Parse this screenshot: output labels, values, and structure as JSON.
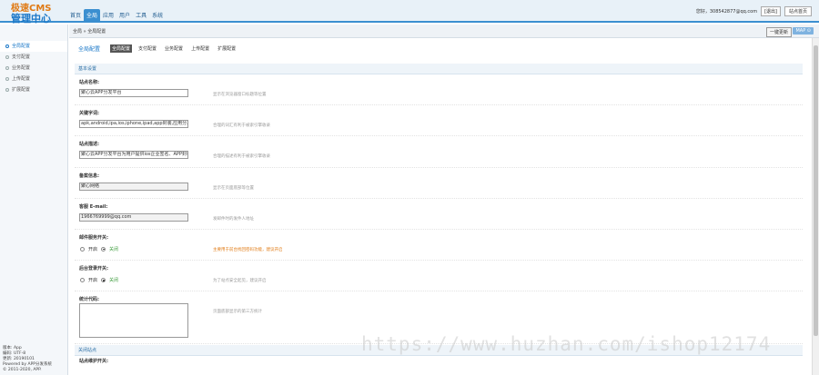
{
  "app": {
    "logo_line1": "极速CMS",
    "logo_line2": "管理中心"
  },
  "nav": [
    "首页",
    "全局",
    "应用",
    "用户",
    "工具",
    "系统"
  ],
  "user_bar": {
    "greeting": "您好，308542877@qq.com",
    "logout": "[退出]",
    "site_home": "站点首页"
  },
  "sidebar": {
    "items": [
      "全局配置",
      "支付配置",
      "业务配置",
      "上传配置",
      "扩展配置"
    ],
    "footer": [
      "版本: App",
      "编码: UTF-8",
      "更新: 20190101",
      "Powered by APP分发系统",
      "© 2011-2020, APP."
    ]
  },
  "breadcrumb": {
    "path": "全局 » 全局配置",
    "update_button": "一键更新",
    "map_button": "MAP ⊙"
  },
  "tabs": {
    "title": "全局配置",
    "items": [
      "全局配置",
      "支付配置",
      "业务配置",
      "上传配置",
      "扩展配置"
    ]
  },
  "sections": {
    "basic": "基本设置",
    "close": "关闭站点"
  },
  "fields": {
    "site_name": {
      "label": "站点名称:",
      "value": "聚心云APP分发平台",
      "hint": "显示在浏览器窗口标题等位置"
    },
    "keywords": {
      "label": "关键字词:",
      "value": "apk,android,ipa,ios,iphone,ipad,app封装,应用分发,企业签名",
      "hint": "合理的词汇有利于被索引擎收录"
    },
    "description": {
      "label": "站点描述:",
      "value": "聚心云APP分发平台为用户提供ios企业签名、APP封装",
      "hint": "合理的描述有利于被索引擎收录"
    },
    "record": {
      "label": "备案信息:",
      "value": "聚心网络",
      "hint": "显示在页面底部等位置"
    },
    "email": {
      "label": "客服 E-mail:",
      "value": "1966769999@qq.com",
      "hint": "发邮件时的发件人地址"
    },
    "mail_switch": {
      "label": "邮件服务开关:",
      "on": "开启",
      "off": "关闭",
      "hint": "主要用于前台找回密码功能，建议开启"
    },
    "log_switch": {
      "label": "后台登录开关:",
      "on": "开启",
      "off": "关闭",
      "hint": "为了站点安全起见，建议开启"
    },
    "stats_code": {
      "label": "统计代码:",
      "hint": "页面底部显示的第三方统计"
    },
    "close_switch": {
      "label": "站点维护开关:"
    }
  },
  "watermark": "https://www.huzhan.com/ishop12174"
}
